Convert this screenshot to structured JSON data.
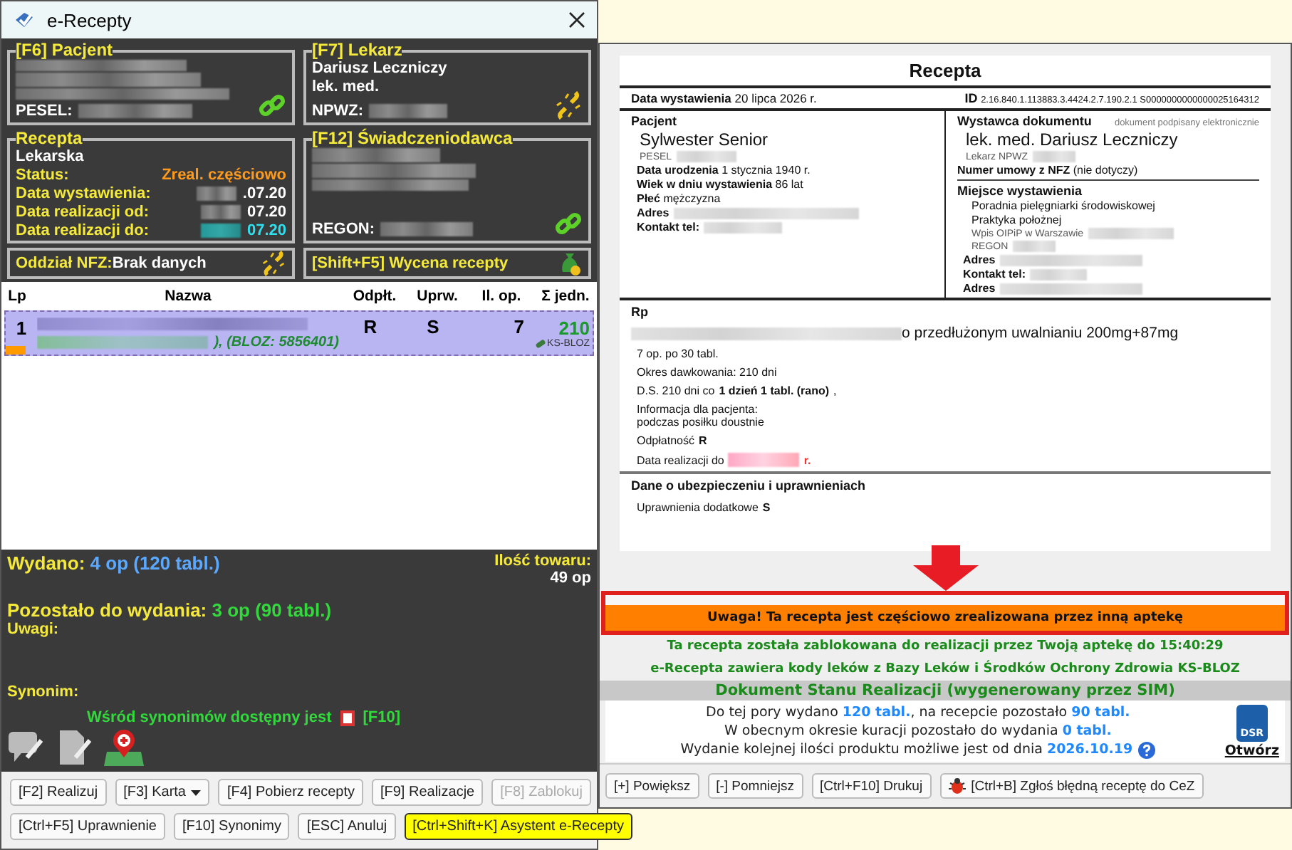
{
  "window": {
    "title": "e-Recepty"
  },
  "patient_panel": {
    "title": "[F6] Pacjent",
    "pesel_label": "PESEL:",
    "linked": true
  },
  "doctor_panel": {
    "title": "[F7] Lekarz",
    "name": "Dariusz Leczniczy",
    "degree": "lek. med.",
    "npwz_label": "NPWZ:",
    "linked": false
  },
  "prescription_panel": {
    "title": "Recepta",
    "type": "Lekarska",
    "status_label": "Status:",
    "status": "Zreal. częściowo",
    "dates": [
      {
        "label": "Data wystawienia:",
        "value": ".07.20",
        "highlighted": false
      },
      {
        "label": "Data realizacji od:",
        "value": "07.20",
        "highlighted": false
      },
      {
        "label": "Data realizacji do:",
        "value": "07.20",
        "highlighted": true
      }
    ]
  },
  "provider_panel": {
    "title": "[F12] Świadczeniodawca",
    "regon_label": "REGON:",
    "linked": true
  },
  "nfz_panel": {
    "label": "Oddział NFZ:",
    "value": "Brak danych",
    "linked": false
  },
  "pricing_panel": {
    "label": "[Shift+F5] Wycena recepty"
  },
  "table": {
    "columns": [
      "Lp",
      "Nazwa",
      "Odpłt.",
      "Uprw.",
      "Il. op.",
      "Σ jedn."
    ],
    "rows": [
      {
        "lp": "1",
        "bloz": "), (BLOZ: 5856401)",
        "payment": "R",
        "entitlement": "S",
        "packs": "7",
        "units": "210",
        "source": "KS-BLOZ",
        "selected": true
      }
    ]
  },
  "summary": {
    "issued_label": "Wydano:",
    "issued_value": "4 op (120 tabl.)",
    "stock_label": "Ilość towaru:",
    "stock_value": "49 op",
    "remaining_label": "Pozostało do wydania:",
    "remaining_value": "3 op (90 tabl.)",
    "notes_label": "Uwagi:",
    "synonym_label": "Synonim:",
    "synonym_note": "Wśród synonimów dostępny jest",
    "synonym_key": "[F10]"
  },
  "button_rows": [
    [
      {
        "label": "[F2] Realizuj",
        "kind": "plain",
        "disabled": false,
        "highlighted": false
      },
      {
        "label": "[F3] Karta",
        "kind": "menu",
        "disabled": false,
        "highlighted": false
      },
      {
        "label": "[F4] Pobierz recepty",
        "kind": "plain",
        "disabled": false,
        "highlighted": false
      },
      {
        "label": "[F9] Realizacje",
        "kind": "plain",
        "disabled": false,
        "highlighted": false
      },
      {
        "label": "[F8] Zablokuj",
        "kind": "plain",
        "disabled": true,
        "highlighted": false
      }
    ],
    [
      {
        "label": "[Ctrl+F5] Uprawnienie",
        "kind": "plain",
        "disabled": false,
        "highlighted": false
      },
      {
        "label": "[F10] Synonimy",
        "kind": "plain",
        "disabled": false,
        "highlighted": false
      },
      {
        "label": "[ESC] Anuluj",
        "kind": "plain",
        "disabled": false,
        "highlighted": false
      },
      {
        "label": "[Ctrl+Shift+K] Asystent e-Recepty",
        "kind": "plain",
        "disabled": false,
        "highlighted": true
      }
    ]
  ],
  "document": {
    "title": "Recepta",
    "issue_date": "**Data wystawienia** 20 lipca 2026 r.",
    "id_label": "ID",
    "id_value": "2.16.840.1.113883.3.4424.2.7.190.2.1 S0000000000000025164312",
    "patient": {
      "heading": "Pacjent",
      "name": "Sylwester Senior",
      "pesel_label": "PESEL",
      "fields": [
        {
          "text": "**Data urodzenia** 1 stycznia 1940 r.",
          "redacted": false
        },
        {
          "text": "**Wiek w dniu wystawienia** 86 lat",
          "redacted": false
        },
        {
          "text": "**Płeć** mężczyzna",
          "redacted": false
        },
        {
          "text": "**Adres**",
          "redacted": true
        },
        {
          "text": "**Kontakt tel:**",
          "redacted": true
        }
      ]
    },
    "issuer": {
      "heading": "Wystawca dokumentu",
      "signed_note": "dokument podpisany elektronicznie",
      "name": "lek. med. Dariusz Leczniczy",
      "npwz_label": "Lekarz NPWZ",
      "contract": "**Numer umowy z NFZ** (nie dotyczy)",
      "place_heading": "Miejsce wystawienia",
      "place_lines": [
        "Poradnia pielęgniarki środowiskowej",
        "Praktyka położnej"
      ],
      "registry_lines": [
        "Wpis OIPiP w Warszawie",
        "REGON"
      ],
      "fields": [
        "Adres",
        "Kontakt tel:",
        "Adres"
      ]
    },
    "rp": {
      "heading": "Rp",
      "drug": "o przedłużonym uwalnianiu 200mg+87mg",
      "lines": [
        "7 op. po 30 tabl.",
        "Okres dawkowania: 210 dni",
        "D.S. 210 dni co **1 dzień 1 tabl. (rano)**,"
      ],
      "info_lines": [
        "Informacja dla pacjenta:",
        "podczas posiłku doustnie"
      ],
      "payment": "Odpłatność **R**",
      "deadline_label": "Data realizacji do",
      "deadline_suffix": "r."
    },
    "insurance": {
      "heading": "Dane o ubezpieczeniu i uprawnieniach",
      "line": "Uprawnienia dodatkowe **S**"
    }
  },
  "alert": "Uwaga! Ta recepta jest częściowo zrealizowana przez inną aptekę",
  "notices": [
    "Ta recepta została zablokowana do realizacji przez Twoją aptekę do 15:40:29",
    "e-Recepta zawiera kody leków z Bazy Leków i Środków Ochrony Zdrowia KS-BLOZ"
  ],
  "dsr": {
    "title": "Dokument Stanu Realizacji (wygenerowany przez SIM)",
    "icon_label": "DSR",
    "link": "Otwórz",
    "lines": [
      {
        "help": false,
        "segments": [
          {
            "text": "Do tej pory wydano ",
            "highlight": false
          },
          {
            "text": "120 tabl.",
            "highlight": true
          },
          {
            "text": ", na recepcie pozostało ",
            "highlight": false
          },
          {
            "text": "90 tabl.",
            "highlight": true
          }
        ]
      },
      {
        "help": false,
        "segments": [
          {
            "text": "W obecnym okresie kuracji pozostało do wydania ",
            "highlight": false
          },
          {
            "text": "0 tabl.",
            "highlight": true
          }
        ]
      },
      {
        "help": true,
        "segments": [
          {
            "text": "Wydanie kolejnej ilości produktu możliwe jest od dnia ",
            "highlight": false
          },
          {
            "text": "2026.10.19",
            "highlight": true
          }
        ]
      }
    ]
  },
  "viewer_buttons": [
    {
      "label": "[+] Powiększ",
      "kind": "plain"
    },
    {
      "label": "[-] Pomniejsz",
      "kind": "plain"
    },
    {
      "label": "[Ctrl+F10] Drukuj",
      "kind": "plain"
    },
    {
      "label": "[Ctrl+B] Zgłoś błędną receptę do CeZ",
      "kind": "bug"
    }
  ]
}
